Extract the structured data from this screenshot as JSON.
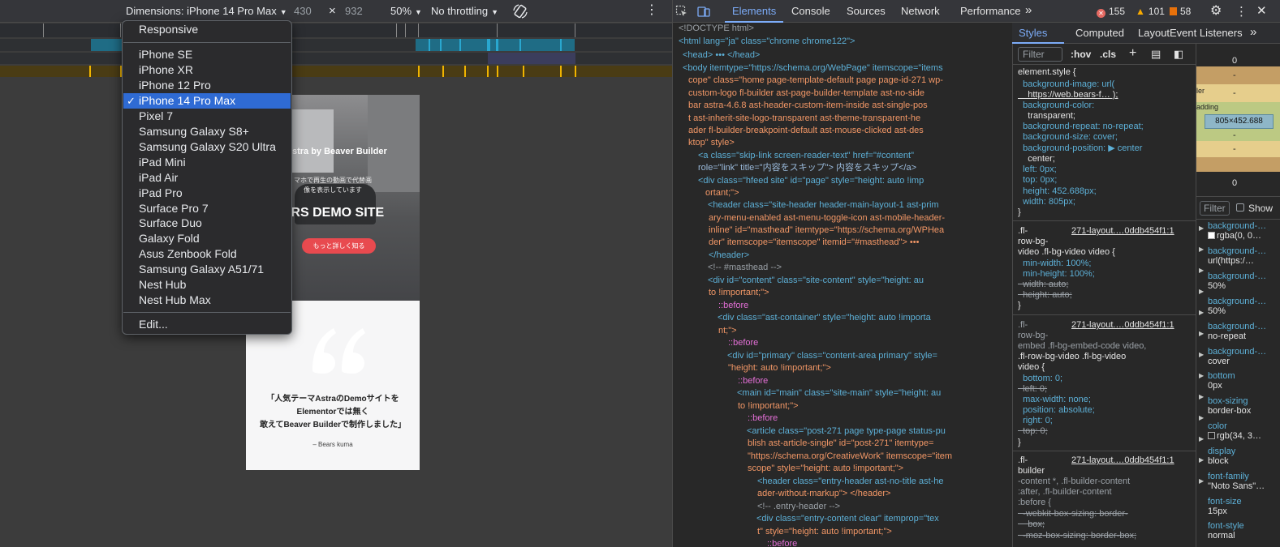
{
  "device_toolbar": {
    "dimensions_label": "Dimensions: iPhone 14 Pro Max",
    "width": "430",
    "height": "932",
    "times": "×",
    "zoom": "50%",
    "throttling": "No throttling",
    "rotate_icon": "rotate-icon",
    "more_icon": "more-vert-icon"
  },
  "device_menu": {
    "items": [
      "Responsive",
      "iPhone SE",
      "iPhone XR",
      "iPhone 12 Pro",
      "iPhone 14 Pro Max",
      "Pixel 7",
      "Samsung Galaxy S8+",
      "Samsung Galaxy S20 Ultra",
      "iPad Mini",
      "iPad Air",
      "iPad Pro",
      "Surface Pro 7",
      "Surface Duo",
      "Galaxy Fold",
      "Asus Zenbook Fold",
      "Samsung Galaxy A51/71",
      "Nest Hub",
      "Nest Hub Max"
    ],
    "selected": "iPhone 14 Pro Max",
    "edit_label": "Edit...",
    "check": "✓"
  },
  "emulated_page": {
    "hero_line1": "e Astra by Beaver Builder",
    "hero_line2a": "マホで再生の動画で代替画",
    "hero_line2b": "像を表示しています",
    "hero_title": "ARS DEMO SITE",
    "hero_button": "もっと詳しく知る",
    "quote_line1": "「人気テーマAstraのDemoサイトを",
    "quote_line2": "Elementorでは無く",
    "quote_line3": "敢えてBeaver Builderで制作しました」",
    "quote_author": "– Bears kuma"
  },
  "devtools": {
    "tabs": [
      "Elements",
      "Console",
      "Sources",
      "Network",
      "Performance"
    ],
    "active_tab": "Elements",
    "more_tabs": "»",
    "errors": "155",
    "warnings": "101",
    "issues": "58",
    "colors": {
      "accent": "#7cacf8",
      "error": "#e46962",
      "warning": "#f9ab00",
      "issue": "#e8710a"
    }
  },
  "dom_lines": [
    "<!DOCTYPE html>",
    "<html lang=\"ja\" class=\"chrome chrome122\">",
    "<head> ••• </head>",
    "<body itemtype=\"https://schema.org/WebPage\" itemscope=\"items",
    "cope\" class=\"home page-template-default page page-id-271 wp-",
    "custom-logo fl-builder ast-page-builder-template ast-no-side",
    "bar astra-4.6.8 ast-header-custom-item-inside ast-single-pos",
    "t ast-inherit-site-logo-transparent ast-theme-transparent-he",
    "ader fl-builder-breakpoint-default ast-mouse-clicked ast-des",
    "ktop\" style>",
    "<a class=\"skip-link screen-reader-text\" href=\"#content\"",
    "role=\"link\" title=\"内容をスキップ\"> 内容をスキップ</a>",
    "<div class=\"hfeed site\" id=\"page\" style=\"height: auto !imp",
    "ortant;\">",
    "<header class=\"site-header header-main-layout-1 ast-prim",
    "ary-menu-enabled ast-menu-toggle-icon ast-mobile-header-",
    "inline\" id=\"masthead\" itemtype=\"https://schema.org/WPHea",
    "der\" itemscope=\"itemscope\" itemid=\"#masthead\"> •••",
    "</header>",
    "<!-- #masthead -->",
    "<div id=\"content\" class=\"site-content\" style=\"height: au",
    "to !important;\">",
    "::before",
    "<div class=\"ast-container\" style=\"height: auto !importa",
    "nt;\">",
    "::before",
    "<div id=\"primary\" class=\"content-area primary\" style=",
    "\"height: auto !important;\">",
    "::before",
    "<main id=\"main\" class=\"site-main\" style=\"height: au",
    "to !important;\">",
    "::before",
    "<article class=\"post-271 page type-page status-pu",
    "blish ast-article-single\" id=\"post-271\" itemtype=",
    "\"https://schema.org/CreativeWork\" itemscope=\"item",
    "scope\" style=\"height: auto !important;\">",
    "<header class=\"entry-header ast-no-title ast-he",
    "ader-without-markup\"> </header>",
    "<!-- .entry-header -->",
    "<div class=\"entry-content clear\" itemprop=\"tex",
    "t\" style=\"height: auto !important;\">",
    "::before"
  ],
  "styles_panel": {
    "subtabs": [
      "Styles",
      "Computed",
      "Layout",
      "Event Listeners"
    ],
    "more": "»",
    "filter_placeholder": "Filter",
    "hov": ":hov",
    "cls": ".cls",
    "element_style": [
      "element.style {",
      "  background-image: url(",
      "    https://web.bears-f… );",
      "  background-color:",
      "    transparent;",
      "  background-repeat: no-repeat;",
      "  background-size: cover;",
      "  background-position: ▶ center",
      "    center;",
      "  left: 0px;",
      "  top: 0px;",
      "  height: 452.688px;",
      "  width: 805px;",
      "}"
    ],
    "rule1_source": "271-layout.…0ddb454f1:1",
    "rule1": [
      ".fl-",
      "row-bg-",
      "video .fl-bg-video video {",
      "  min-width: 100%;",
      "  min-height: 100%;",
      "  width: auto;",
      "  height: auto;",
      "}"
    ],
    "rule2_source": "271-layout.…0ddb454f1:1",
    "rule2": [
      ".fl-",
      "row-bg-",
      "embed .fl-bg-embed-code video,",
      ".fl-row-bg-video .fl-bg-video",
      "video {",
      "  bottom: 0;",
      "  left: 0;",
      "  max-width: none;",
      "  position: absolute;",
      "  right: 0;",
      "  top: 0;",
      "}"
    ],
    "rule3_source": "271-layout.…0ddb454f1:1",
    "rule3": [
      ".fl-",
      "builder",
      "-content *, .fl-builder-content",
      ":after, .fl-builder-content",
      ":before {",
      "  -webkit-box-sizing: border-",
      "    box;",
      "  -moz-box-sizing: border-box;"
    ]
  },
  "computed_panel": {
    "box_values": [
      "0",
      "-",
      "-",
      "805×452.688",
      "-",
      "-",
      "0"
    ],
    "box_labels": [
      "ler",
      "adding"
    ],
    "filter_placeholder": "Filter",
    "show_all": "Show",
    "props": [
      [
        "background-…",
        "rgba(0, 0…"
      ],
      [
        "background-…",
        "url(https:/…"
      ],
      [
        "background-…",
        "50%"
      ],
      [
        "background-…",
        "50%"
      ],
      [
        "background-…",
        "no-repeat"
      ],
      [
        "background-…",
        "cover"
      ],
      [
        "bottom",
        "0px"
      ],
      [
        "box-sizing",
        "border-box"
      ],
      [
        "color",
        "rgb(34, 3…"
      ],
      [
        "display",
        "block"
      ],
      [
        "font-family",
        "\"Noto Sans\"…"
      ],
      [
        "font-size",
        "15px"
      ],
      [
        "font-style",
        "normal"
      ]
    ]
  }
}
